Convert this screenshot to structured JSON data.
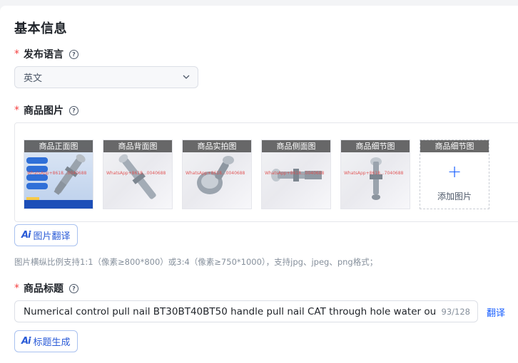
{
  "section": {
    "title": "基本信息"
  },
  "language": {
    "label": "发布语言",
    "required_mark": "*",
    "help_icon": "question-circle-icon",
    "value": "英文"
  },
  "images": {
    "label": "商品图片",
    "required_mark": "*",
    "help_icon": "question-circle-icon",
    "thumbnails": [
      {
        "tag": "商品正面图",
        "watermark": "WhatsApp+8618...0040688"
      },
      {
        "tag": "商品背面图",
        "watermark": "WhatsApp+8618...0040688"
      },
      {
        "tag": "商品实拍图",
        "watermark": "WhatsApp+8618...0040688"
      },
      {
        "tag": "商品侧面图",
        "watermark": "WhatsApp+8618...0040688"
      },
      {
        "tag": "商品细节图",
        "watermark": "WhatsApp+8618...7040688"
      }
    ],
    "add_slot": {
      "tag": "商品细节图",
      "plus": "+",
      "label": "添加图片"
    },
    "translate_button": {
      "ai": "Ai",
      "label": "图片翻译"
    },
    "hint": "图片横纵比例支持1:1（像素≥800*800）或3:4（像素≥750*1000），支持jpg、jpeg、png格式；"
  },
  "product_title": {
    "label": "商品标题",
    "required_mark": "*",
    "help_icon": "question-circle-icon",
    "value": "Numerical control pull nail BT30BT40BT50 handle pull nail CAT through hole water outlet",
    "count": "93/128",
    "translate_link": "翻译",
    "generate_button": {
      "ai": "Ai",
      "label": "标题生成"
    }
  },
  "colors": {
    "accent": "#165dff",
    "required": "#f53f3f",
    "border": "#dcdfe6"
  }
}
